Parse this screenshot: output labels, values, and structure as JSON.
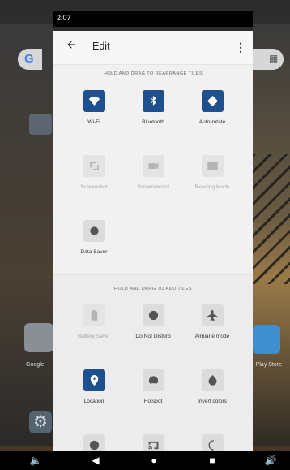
{
  "status_bar": {
    "time": "2:07"
  },
  "header": {
    "title": "Edit"
  },
  "sections": {
    "current": "HOLD AND DRAG TO REARRANGE TILES",
    "add": "HOLD AND DRAG TO ADD TILES"
  },
  "current_tiles": [
    {
      "label": "Wi-Fi",
      "icon": "wifi-icon",
      "state": "active"
    },
    {
      "label": "Bluetooth",
      "icon": "bluetooth-icon",
      "state": "active"
    },
    {
      "label": "Auto-rotate",
      "icon": "auto-rotate-icon",
      "state": "active"
    },
    {
      "label": "Screenshot",
      "icon": "screenshot-icon",
      "state": "disabled"
    },
    {
      "label": "Screenrecord",
      "icon": "screenrecord-icon",
      "state": "disabled"
    },
    {
      "label": "Reading Mode",
      "icon": "reading-mode-icon",
      "state": "disabled"
    },
    {
      "label": "Data Saver",
      "icon": "data-saver-icon",
      "state": "inactive"
    }
  ],
  "add_tiles": [
    {
      "label": "Battery Saver",
      "icon": "battery-icon",
      "state": "disabled"
    },
    {
      "label": "Do Not Disturb",
      "icon": "do-not-disturb-icon",
      "state": "inactive"
    },
    {
      "label": "Airplane mode",
      "icon": "airplane-icon",
      "state": "inactive"
    },
    {
      "label": "Location",
      "icon": "location-icon",
      "state": "active"
    },
    {
      "label": "Hotspot",
      "icon": "hotspot-icon",
      "state": "inactive"
    },
    {
      "label": "Invert colors",
      "icon": "invert-colors-icon",
      "state": "inactive"
    },
    {
      "label": "",
      "icon": "contrast-icon",
      "state": "inactive"
    },
    {
      "label": "",
      "icon": "cast-icon",
      "state": "inactive"
    },
    {
      "label": "",
      "icon": "night-light-icon",
      "state": "inactive"
    }
  ],
  "background_apps": {
    "search_logo": "G",
    "left_folder_label": "Google",
    "right_app_label": "Play Store"
  },
  "colors": {
    "accent": "#1e4f8f",
    "panel": "#f1f1f1",
    "navbar": "#000000"
  }
}
